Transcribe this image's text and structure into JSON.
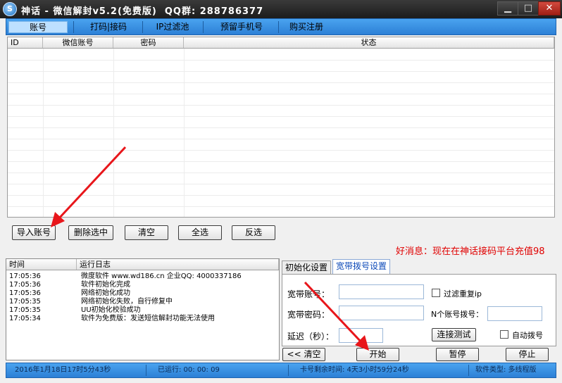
{
  "window": {
    "title": "神话 - 微信解封v5.2(免费版)  QQ群: 288786377",
    "min_glyph": "▁",
    "max_glyph": "□",
    "close_glyph": "✕"
  },
  "tabs": [
    "账号",
    "打码|接码",
    "IP过滤池",
    "预留手机号",
    "购买注册"
  ],
  "grid": {
    "columns": [
      "ID",
      "微信账号",
      "密码",
      "状态"
    ]
  },
  "account_buttons": {
    "import": "导入账号",
    "delete_selected": "删除选中",
    "clear": "清空",
    "select_all": "全选",
    "invert": "反选"
  },
  "ticker": "好消息：现在在神话接码平台充值98",
  "log": {
    "columns": [
      "时间",
      "运行日志"
    ],
    "rows": [
      {
        "time": "17:05:36",
        "msg": "微度软件 www.wd186.cn  企业QQ: 4000337186"
      },
      {
        "time": "17:05:36",
        "msg": "软件初始化完成"
      },
      {
        "time": "17:05:36",
        "msg": "网络初始化成功"
      },
      {
        "time": "17:05:35",
        "msg": "网络初始化失败，自行修复中"
      },
      {
        "time": "17:05:35",
        "msg": "UU初始化校验成功"
      },
      {
        "time": "17:05:34",
        "msg": "软件为免费版：发送短信解封功能无法使用"
      }
    ]
  },
  "settings_tabs": [
    "初始化设置",
    "宽带拨号设置"
  ],
  "broadband": {
    "account_label": "宽带账号：",
    "password_label": "宽带密码：",
    "delay_label": "延迟（秒）：",
    "filter_ip_label": "过滤重复ip",
    "n_dial_label": "N个账号拨号：",
    "test_button": "连接测试",
    "auto_dial_label": "自动拨号"
  },
  "controls": {
    "clear": "<< 清空",
    "start": "开始",
    "pause": "暂停",
    "stop": "停止"
  },
  "status": {
    "datetime": "2016年1月18日17时5分43秒",
    "running": "已运行: 00: 00: 09",
    "remaining": "卡号剩余时间: 4天3小时59分24秒",
    "software_type": "软件类型: 多线程版"
  },
  "colors": {
    "accent": "#2c80d6",
    "ticker": "#e00000",
    "arrow": "#e8161b"
  }
}
